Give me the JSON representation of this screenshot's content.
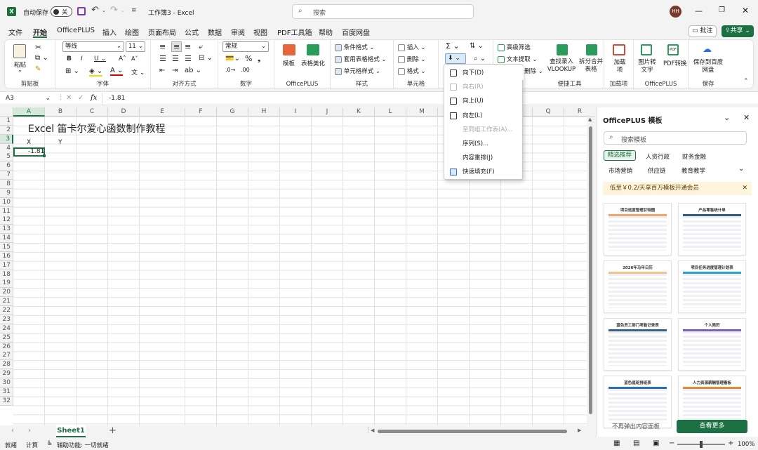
{
  "titlebar": {
    "autosave_label": "自动保存",
    "autosave_state": "关",
    "title": "工作簿3 - Excel",
    "search_placeholder": "搜索",
    "user_initials": "HH"
  },
  "tabs": [
    "文件",
    "开始",
    "OfficePLUS",
    "插入",
    "绘图",
    "页面布局",
    "公式",
    "数据",
    "审阅",
    "视图",
    "PDF工具箱",
    "帮助",
    "百度网盘"
  ],
  "active_tab": "开始",
  "comment_button": "批注",
  "share_button": "共享",
  "ribbon": {
    "clipboard": {
      "paste": "粘贴",
      "label": "剪贴板"
    },
    "font": {
      "name": "等线",
      "size": "11",
      "label": "字体"
    },
    "alignment": {
      "label": "对齐方式"
    },
    "number": {
      "format": "常规",
      "label": "数字"
    },
    "officeplus": {
      "template": "模板",
      "beautify": "表格美化",
      "label": "OfficePLUS"
    },
    "styles": {
      "conditional": "条件格式",
      "table_format": "套用表格格式",
      "cell_style": "单元格样式",
      "label": "样式"
    },
    "cells": {
      "insert": "插入",
      "delete": "删除",
      "format": "格式",
      "label": "单元格"
    },
    "tools": {
      "advanced_filter": "高级筛选",
      "text_extract": "文本提取",
      "delete_short": "删除",
      "vlookup": "查找录入VLOOKUP",
      "split_merge": "拆分合并表格",
      "label": "便捷工具"
    },
    "addins": {
      "addin": "加载项",
      "label": "加载项"
    },
    "officeplus2": {
      "image_to_text": "图片转文字",
      "pdf_convert": "PDF转换",
      "label": "OfficePLUS"
    },
    "save": {
      "save_baidu": "保存到百度网盘",
      "label": "保存"
    }
  },
  "formula_bar": {
    "name_box": "A3",
    "fx": "fx",
    "value": "-1.81"
  },
  "columns": [
    "A",
    "B",
    "C",
    "D",
    "E",
    "F",
    "G",
    "H",
    "I",
    "J",
    "K",
    "L",
    "M",
    "N",
    "O",
    "P",
    "Q",
    "R"
  ],
  "rows": [
    "1",
    "2",
    "3",
    "4",
    "5",
    "6",
    "7",
    "8",
    "9",
    "10",
    "11",
    "12",
    "13",
    "14",
    "15",
    "16",
    "17",
    "18",
    "19",
    "20",
    "21",
    "22",
    "23",
    "24",
    "25",
    "26",
    "27",
    "28",
    "29",
    "30",
    "31",
    "32"
  ],
  "cells": {
    "title": "Excel 笛卡尔爱心函数制作教程",
    "x_header": "X",
    "y_header": "Y",
    "a3": "-1.81"
  },
  "fill_menu": {
    "items": [
      {
        "label": "向下(D)",
        "enabled": true
      },
      {
        "label": "向右(R)",
        "enabled": false
      },
      {
        "label": "向上(U)",
        "enabled": true
      },
      {
        "label": "向左(L)",
        "enabled": true
      },
      {
        "label": "至同组工作表(A)...",
        "enabled": false
      },
      {
        "label": "序列(S)...",
        "enabled": true
      },
      {
        "label": "内容重排(J)",
        "enabled": true
      },
      {
        "label": "快速填充(F)",
        "enabled": true
      }
    ]
  },
  "panel": {
    "title": "OfficePLUS 模板",
    "search_placeholder": "搜索模板",
    "categories": [
      "精选推荐",
      "人资行政",
      "财务金融",
      "市场营销",
      "供应链",
      "教育教学"
    ],
    "promo": "低至￥0.2/天享百万模板开通会员",
    "templates": [
      "项目进度管理甘特图",
      "产品零售统计单",
      "2026年马年日历",
      "项目任务进度管理计划表",
      "蓝色员工部门考勤记录表",
      "个人简历",
      "蓝色值班排班表",
      "人力资源薪酬管理看板"
    ],
    "no_popup": "不再弹出内容面板",
    "more": "查看更多"
  },
  "sheet_tab": "Sheet1",
  "status": {
    "ready": "就绪",
    "calc": "计算",
    "accessibility": "辅助功能: 一切就绪",
    "zoom": "100%"
  },
  "colors": {
    "accent": "#1d7044",
    "selected_tab": "#1d7044"
  }
}
